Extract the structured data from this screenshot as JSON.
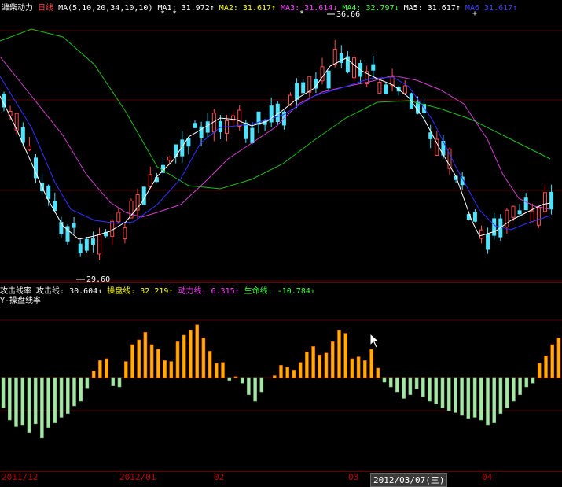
{
  "top_header": {
    "stock_name": "潍柴动力",
    "period": "日线",
    "ma_params": "MA(5,10,20,34,10,10)",
    "ma1": "MA1: 31.972↑",
    "ma2": "MA2: 31.617↑",
    "ma3": "MA3: 31.614↓",
    "ma4": "MA4: 32.797↓",
    "ma5": "MA5: 31.617↑",
    "ma6": "MA6  31.617↑"
  },
  "price_annotations": {
    "high": "36.66",
    "low": "29.60"
  },
  "lower_header": {
    "indicator": "攻击线率",
    "attack": "攻击线: 30.604↑",
    "control": "操盘线: 32.219↑",
    "momentum": "动力线: 6.315↑",
    "life": "生命线: -10.784↑",
    "line2": "Y-操盘线率"
  },
  "date_axis": {
    "labels": [
      "2011/12",
      "2012/01",
      "02",
      "03",
      "04"
    ],
    "highlight": "2012/03/07(三)"
  },
  "chart_data": {
    "type": "bar",
    "series": [
      {
        "values": [
          -3.2,
          -4.5,
          -5.2,
          -5.0,
          -5.8,
          -4.9,
          -6.4,
          -5.3,
          -4.8,
          -4.2,
          -3.8,
          -3.0,
          -2.5,
          -1.1,
          0.7,
          1.8,
          2.0,
          -0.8,
          -1.0,
          1.7,
          3.5,
          4.0,
          4.8,
          3.5,
          3.0,
          1.8,
          1.7,
          3.8,
          4.5,
          5.0,
          5.6,
          4.2,
          2.8,
          1.5,
          1.6,
          -0.3,
          0.1,
          -0.6,
          -1.8,
          -2.5,
          -1.5,
          0.0,
          0.2,
          1.3,
          1.1,
          0.8,
          1.6,
          2.7,
          3.3,
          2.4,
          2.6,
          3.8,
          5.0,
          4.7,
          2.0,
          2.2,
          1.8,
          3.0,
          1.0,
          -0.5,
          -1.0,
          -1.5,
          -2.2,
          -1.8,
          -1.2,
          -2.0,
          -2.5,
          -2.8,
          -3.2,
          -3.5,
          -3.7,
          -4.0,
          -4.3,
          -4.2,
          -4.5,
          -5.0,
          -4.8,
          -3.8,
          -3.2,
          -2.5,
          -1.8,
          -1.0,
          -0.6,
          1.5,
          2.3,
          3.5,
          4.2
        ]
      }
    ]
  }
}
